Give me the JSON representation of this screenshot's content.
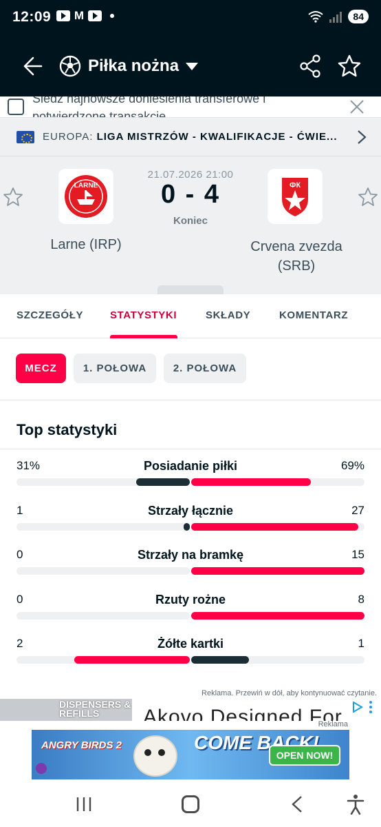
{
  "status_bar": {
    "time": "12:09",
    "battery": "84",
    "icons": [
      "youtube-icon",
      "gmail-icon",
      "youtube-icon",
      "notification-dot",
      "wifi-icon",
      "signal-icon"
    ]
  },
  "app_bar": {
    "sport": "Piłka nożna",
    "icons": [
      "back-arrow-icon",
      "soccer-ball-icon",
      "chevron-down-icon",
      "share-icon",
      "star-icon"
    ]
  },
  "transfer_banner": {
    "text": "Śledź najnowsze doniesienia transferowe i potwierdzone transakcje"
  },
  "competition": {
    "prefix": "EUROPA:",
    "name": "LIGA MISTRZÓW - KWALIFIKACJE - ĆWIE..."
  },
  "match": {
    "date": "21.07.2026 21:00",
    "score": "0 - 4",
    "status": "Koniec",
    "home_team": "Larne (IRP)",
    "away_team": "Crvena zvezda (SRB)",
    "home_logo_text": "LARNE",
    "away_logo_text": "ФК"
  },
  "tabs": [
    {
      "label": "SZCZEGÓŁY",
      "active": false
    },
    {
      "label": "STATYSTYKI",
      "active": true
    },
    {
      "label": "SKŁADY",
      "active": false
    },
    {
      "label": "KOMENTARZ",
      "active": false
    }
  ],
  "periods": [
    {
      "label": "MECZ",
      "active": true
    },
    {
      "label": "1. POŁOWA",
      "active": false
    },
    {
      "label": "2. POŁOWA",
      "active": false
    }
  ],
  "stats": {
    "title": "Top statystyki",
    "rows": [
      {
        "name": "Posiadanie piłki",
        "home": "31%",
        "away": "69%",
        "home_val": 31,
        "away_val": 69
      },
      {
        "name": "Strzały łącznie",
        "home": "1",
        "away": "27",
        "home_val": 1,
        "away_val": 27
      },
      {
        "name": "Strzały na bramkę",
        "home": "0",
        "away": "15",
        "home_val": 0,
        "away_val": 15
      },
      {
        "name": "Rzuty rożne",
        "home": "0",
        "away": "8",
        "home_val": 0,
        "away_val": 8
      },
      {
        "name": "Żółte kartki",
        "home": "2",
        "away": "1",
        "home_val": 2,
        "away_val": 1
      }
    ]
  },
  "ads": {
    "note": "Reklama. Przewiń w dół, aby kontynuować czytanie.",
    "thumb_text": "DISPENSERS & REFILLS",
    "headline": "Akovo Designed For",
    "label": "Reklama",
    "banner_game": "ANGRY BIRDS 2",
    "banner_headline": "COME BACK!",
    "banner_cta": "OPEN NOW!"
  },
  "colors": {
    "header_bg": "#00141e",
    "accent": "#ff0046",
    "home_bar": "#1b2d35",
    "panel_bg": "#eef0f2"
  }
}
